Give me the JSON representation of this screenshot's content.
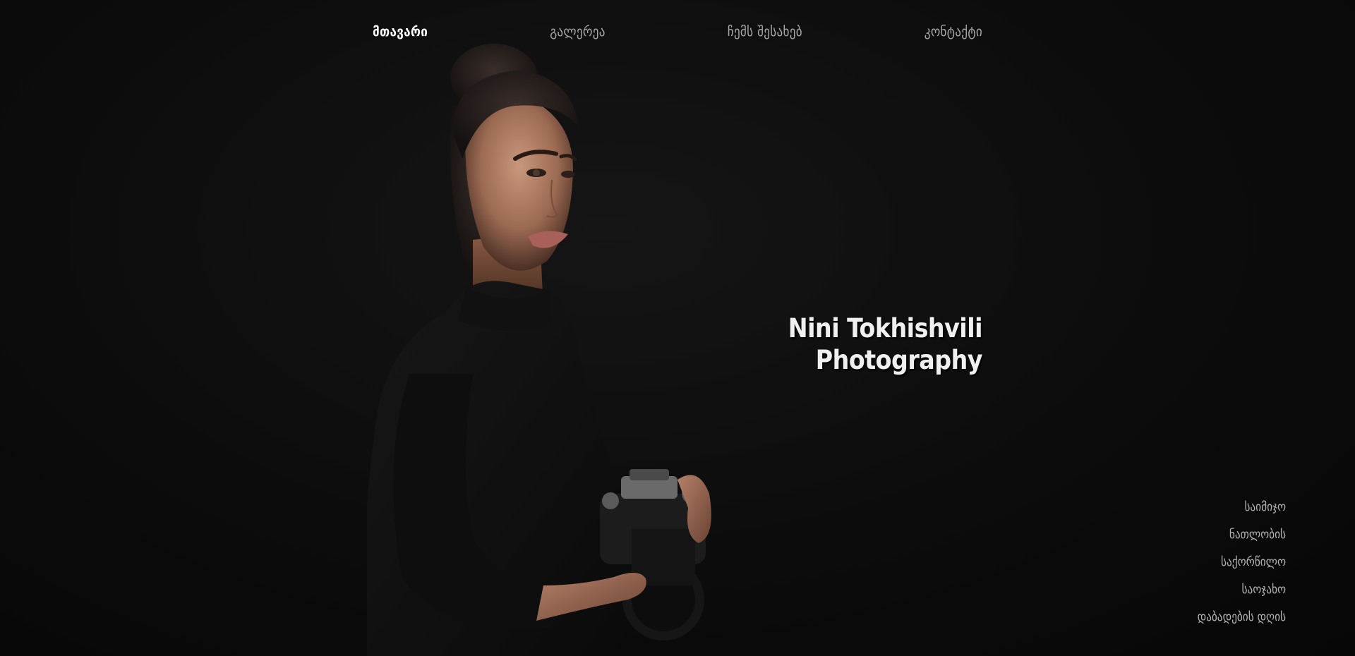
{
  "nav": {
    "items": [
      {
        "label": "მთავარი",
        "active": true
      },
      {
        "label": "გალერეა",
        "active": false
      },
      {
        "label": "ჩემს შესახებ",
        "active": false
      },
      {
        "label": "კონტაქტი",
        "active": false
      }
    ]
  },
  "hero": {
    "title_line1": "Nini Tokhishvili",
    "title_line2": "Photography"
  },
  "categories": [
    {
      "label": "საიმიჯო"
    },
    {
      "label": "ნათლობის"
    },
    {
      "label": "საქორწილო"
    },
    {
      "label": "საოჯახო"
    },
    {
      "label": "დაბადების დღის"
    }
  ],
  "colors": {
    "background": "#0b0b0b",
    "nav_active": "#ffffff",
    "nav_inactive": "#a9a9a9",
    "title": "#f0f0f0"
  }
}
